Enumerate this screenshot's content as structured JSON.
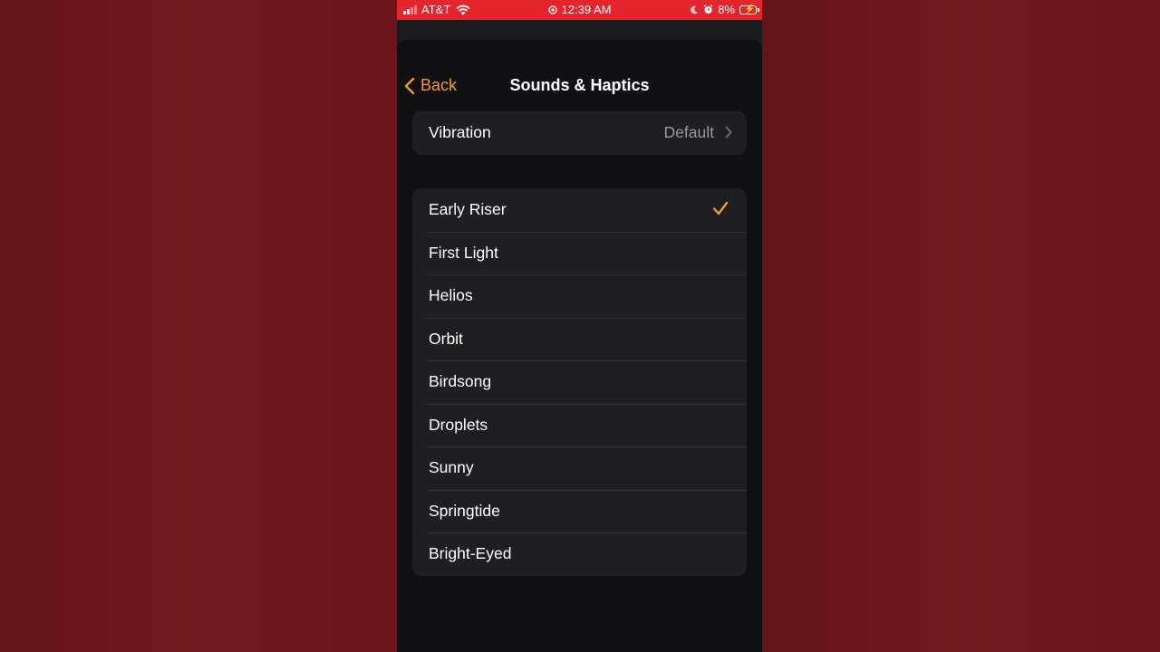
{
  "status_bar": {
    "carrier": "AT&T",
    "time": "12:39 AM",
    "battery": "8%"
  },
  "nav": {
    "back_label": "Back",
    "title": "Sounds & Haptics"
  },
  "vibration": {
    "label": "Vibration",
    "value": "Default"
  },
  "sounds": {
    "selected": "Early Riser",
    "items": [
      {
        "label": "Early Riser"
      },
      {
        "label": "First Light"
      },
      {
        "label": "Helios"
      },
      {
        "label": "Orbit"
      },
      {
        "label": "Birdsong"
      },
      {
        "label": "Droplets"
      },
      {
        "label": "Sunny"
      },
      {
        "label": "Springtide"
      },
      {
        "label": "Bright-Eyed"
      }
    ]
  },
  "colors": {
    "accent": "#f09a36",
    "status_bar": "#e5242b",
    "background": "#6b161b"
  }
}
